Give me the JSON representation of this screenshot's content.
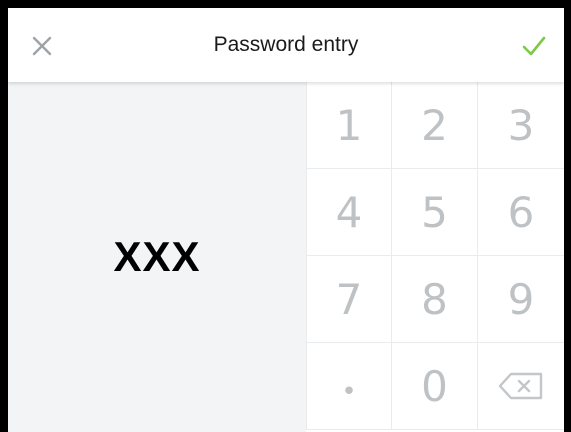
{
  "header": {
    "title": "Password entry",
    "close_icon": "close-icon",
    "confirm_icon": "checkmark-icon",
    "accent_color": "#7cc94a"
  },
  "display": {
    "value": "XXX"
  },
  "keypad": {
    "keys": [
      "1",
      "2",
      "3",
      "4",
      "5",
      "6",
      "7",
      "8",
      "9",
      "•",
      "0"
    ],
    "backspace_icon": "backspace-icon"
  }
}
